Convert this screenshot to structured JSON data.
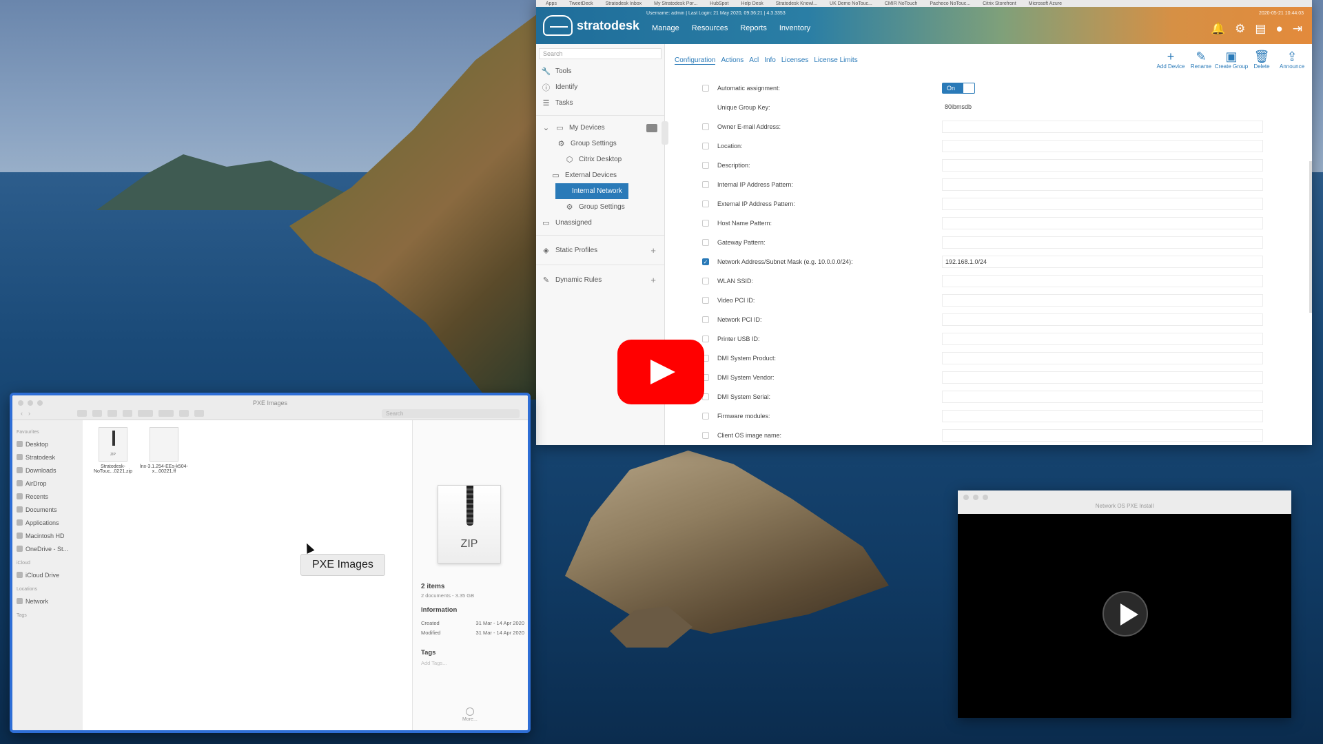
{
  "browser": {
    "bookmarks": [
      "Apps",
      "TweetDeck",
      "Stratodesk Inbox",
      "My Stratodesk Por...",
      "HubSpot",
      "Help Desk",
      "Stratodesk Knowl...",
      "UK Demo NoTouc...",
      "CMIR NoTouch",
      "Pacheco NoTouc...",
      "Citrix Storefront",
      "Microsoft Azure"
    ]
  },
  "stratodesk": {
    "logo": "stratodesk",
    "user_line": "Username: admin | Last Login: 21 May 2020, 09:36:21 | 4.3.3353",
    "date_line": "2020-05-21 10:44:03",
    "nav": [
      "Manage",
      "Resources",
      "Reports",
      "Inventory"
    ],
    "search_placeholder": "Search",
    "sidebar": {
      "tools": "Tools",
      "identify": "Identify",
      "tasks": "Tasks",
      "my_devices": "My Devices",
      "group_settings_1": "Group Settings",
      "citrix_desktop": "Citrix Desktop",
      "external_devices": "External Devices",
      "internal_network": "Internal Network",
      "group_settings_2": "Group Settings",
      "unassigned": "Unassigned",
      "static_profiles": "Static Profiles",
      "dynamic_rules": "Dynamic Rules",
      "plus": "+"
    },
    "tabs": [
      "Configuration",
      "Actions",
      "Acl",
      "Info",
      "Licenses",
      "License Limits"
    ],
    "actions": [
      {
        "icon": "+",
        "label": "Add Device"
      },
      {
        "icon": "✎",
        "label": "Rename"
      },
      {
        "icon": "▣",
        "label": "Create Group"
      },
      {
        "icon": "🗑",
        "label": "Delete"
      },
      {
        "icon": "⇪",
        "label": "Announce"
      }
    ],
    "form": {
      "automatic_assignment": "Automatic assignment:",
      "toggle_on": "On",
      "unique_group_key_label": "Unique Group Key:",
      "unique_group_key_value": "80ibmsdb",
      "owner_email": "Owner E-mail Address:",
      "location": "Location:",
      "description": "Description:",
      "internal_ip": "Internal IP Address Pattern:",
      "external_ip": "External IP Address Pattern:",
      "host_name": "Host Name Pattern:",
      "gateway": "Gateway Pattern:",
      "network_subnet_label": "Network Address/Subnet Mask (e.g. 10.0.0.0/24):",
      "network_subnet_value": "192.168.1.0/24",
      "wlan_ssid": "WLAN SSID:",
      "video_pci": "Video PCI ID:",
      "network_pci": "Network PCI ID:",
      "printer_usb": "Printer USB ID:",
      "dmi_product": "DMI System Product:",
      "dmi_vendor": "DMI System Vendor:",
      "dmi_serial": "DMI System Serial:",
      "firmware": "Firmware modules:",
      "client_os": "Client OS image name:"
    }
  },
  "finder": {
    "title": "PXE Images",
    "search_placeholder": "Search",
    "favourites_header": "Favourites",
    "favourites": [
      "Desktop",
      "Stratodesk",
      "Downloads",
      "AirDrop",
      "Recents",
      "Documents",
      "Applications",
      "Macintosh HD",
      "OneDrive - St..."
    ],
    "icloud_header": "iCloud",
    "icloud": [
      "iCloud Drive"
    ],
    "locations_header": "Locations",
    "locations": [
      "Network"
    ],
    "tags_header": "Tags",
    "files": [
      {
        "name": "Stratodesk-NoTouc...0221.zip",
        "type": "zip"
      },
      {
        "name": "lnx-3.1.254-EEs-k504-x...00221.ff",
        "type": "doc"
      }
    ],
    "tooltip": "PXE Images",
    "preview": {
      "zip_label": "ZIP",
      "items": "2 items",
      "items_detail": "2 documents - 3.35 GB",
      "info_header": "Information",
      "created_label": "Created",
      "created_value": "31 Mar - 14 Apr 2020",
      "modified_label": "Modified",
      "modified_value": "31 Mar - 14 Apr 2020",
      "tags_header": "Tags",
      "add_tags": "Add Tags...",
      "more": "More..."
    }
  },
  "player": {
    "title": "Network OS PXE Install"
  },
  "colors": {
    "accent": "#2a7ab8",
    "youtube_red": "#ff0000",
    "finder_border": "#2e6ed6"
  }
}
